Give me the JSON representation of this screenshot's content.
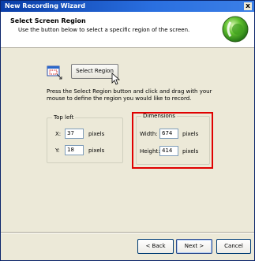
{
  "window": {
    "title": "New Recording Wizard",
    "close_glyph": "x"
  },
  "header": {
    "title": "Select Screen Region",
    "subtitle": "Use the button below to select a specific region of the screen.",
    "logo_icon": "green-orb-logo"
  },
  "select_region": {
    "button_label": "Select Region"
  },
  "instructions": "Press the Select Region button and click and drag with your mouse to define the region you would like to record.",
  "top_left": {
    "legend": "Top left",
    "x_label": "X:",
    "x_value": "37",
    "x_unit": "pixels",
    "y_label": "Y:",
    "y_value": "18",
    "y_unit": "pixels"
  },
  "dimensions": {
    "legend": "Dimensions",
    "width_label": "Width:",
    "width_value": "674",
    "width_unit": "pixels",
    "height_label": "Height:",
    "height_value": "414",
    "height_unit": "pixels",
    "highlight_color": "#e00000"
  },
  "footer": {
    "back": "< Back",
    "next": "Next >",
    "cancel": "Cancel"
  }
}
